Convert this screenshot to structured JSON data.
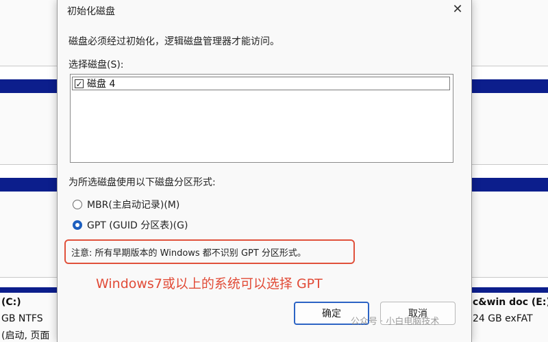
{
  "background": {
    "left_volume_title": "(C:)",
    "left_volume_size": "GB NTFS",
    "left_volume_status": "(启动, 页面",
    "right_volume_title": "c&win doc (E:)",
    "right_volume_size": "24 GB exFAT"
  },
  "dialog": {
    "title": "初始化磁盘",
    "close_icon": "close-icon",
    "description": "磁盘必须经过初始化，逻辑磁盘管理器才能访问。",
    "select_label": "选择磁盘(S):",
    "disks": [
      {
        "label": "磁盘 4",
        "checked": true
      }
    ],
    "format_label": "为所选磁盘使用以下磁盘分区形式:",
    "options": [
      {
        "label": "MBR(主启动记录)(M)",
        "selected": false
      },
      {
        "label": "GPT (GUID 分区表)(G)",
        "selected": true
      }
    ],
    "note": "注意: 所有早期版本的 Windows 都不识别 GPT 分区形式。",
    "ok_label": "确定",
    "cancel_label": "取消"
  },
  "annotation": "Windows7或以上的系统可以选择 GPT",
  "watermark": "公众号 · 小白电脑技术",
  "colors": {
    "accent": "#1d5fbf",
    "highlight": "#e0503a",
    "disk_bar": "#0c1e8c"
  }
}
